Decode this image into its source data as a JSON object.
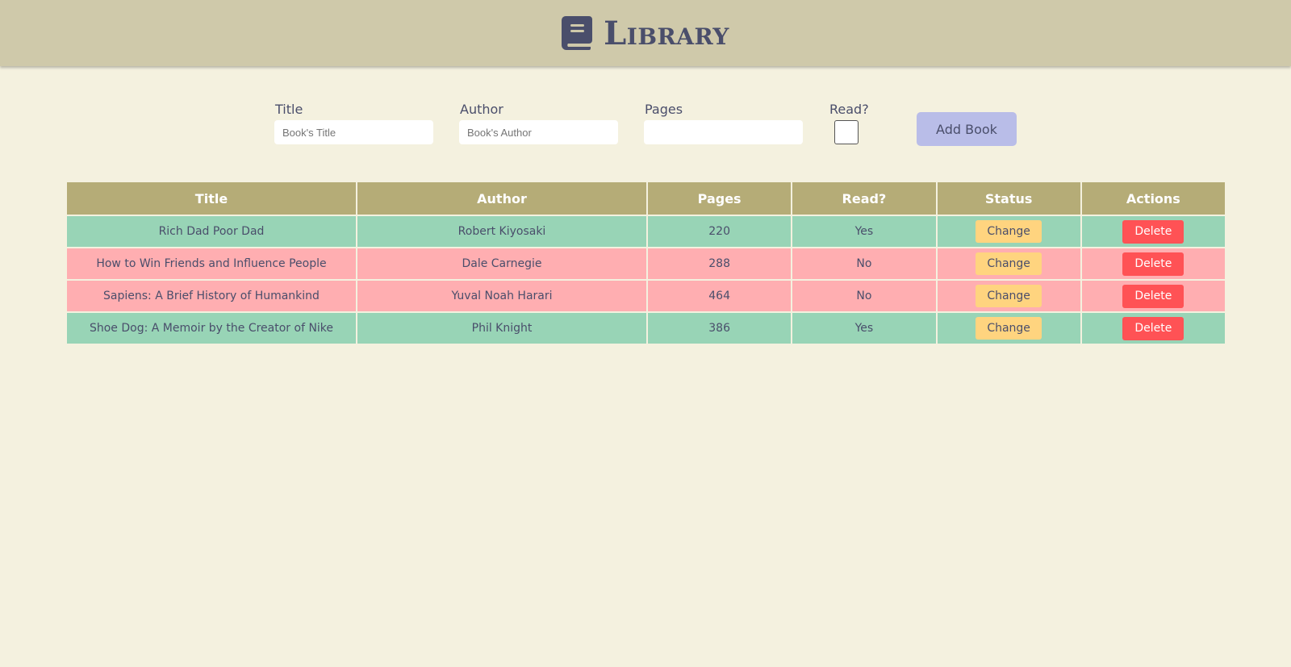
{
  "header": {
    "title": "Library",
    "icon": "book-icon"
  },
  "form": {
    "title_label": "Title",
    "title_placeholder": "Book's Title",
    "author_label": "Author",
    "author_placeholder": "Book's Author",
    "pages_label": "Pages",
    "pages_placeholder": "",
    "read_label": "Read?",
    "read_checked": false,
    "add_button": "Add Book"
  },
  "table": {
    "columns": [
      "Title",
      "Author",
      "Pages",
      "Read?",
      "Status",
      "Actions"
    ],
    "change_label": "Change",
    "delete_label": "Delete",
    "rows": [
      {
        "title": "Rich Dad Poor Dad",
        "author": "Robert Kiyosaki",
        "pages": "220",
        "read": "Yes"
      },
      {
        "title": "How to Win Friends and Influence People",
        "author": "Dale Carnegie",
        "pages": "288",
        "read": "No"
      },
      {
        "title": "Sapiens: A Brief History of Humankind",
        "author": "Yuval Noah Harari",
        "pages": "464",
        "read": "No"
      },
      {
        "title": "Shoe Dog: A Memoir by the Creator of Nike",
        "author": "Phil Knight",
        "pages": "386",
        "read": "Yes"
      }
    ]
  },
  "colors": {
    "header_bg": "#cfc9aa",
    "page_bg": "#f4f1df",
    "table_header_bg": "#b5ac77",
    "row_read_bg": "#98d4b6",
    "row_unread_bg": "#ffaeb1",
    "change_button_bg": "#ffd47f",
    "delete_button_bg": "#ff5255",
    "add_button_bg": "#b9bde8"
  }
}
